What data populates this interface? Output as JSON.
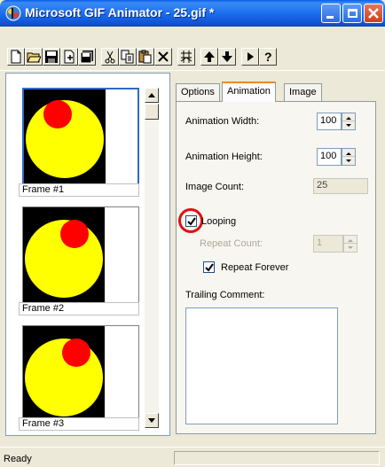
{
  "window": {
    "title": "Microsoft GIF Animator - 25.gif *"
  },
  "toolbar": {
    "buttons": [
      {
        "name": "new-button",
        "icon": "new-file-icon"
      },
      {
        "name": "open-button",
        "icon": "open-folder-icon"
      },
      {
        "name": "save-button",
        "icon": "save-disk-icon"
      },
      {
        "name": "insert-button",
        "icon": "insert-icon"
      },
      {
        "name": "save-as-button",
        "icon": "save-as-icon"
      },
      {
        "name": "cut-button",
        "icon": "scissors-icon"
      },
      {
        "name": "copy-button",
        "icon": "copy-icon"
      },
      {
        "name": "paste-button",
        "icon": "paste-icon"
      },
      {
        "name": "delete-button",
        "icon": "delete-x-icon"
      },
      {
        "name": "select-all-button",
        "icon": "select-all-icon"
      },
      {
        "name": "move-up-button",
        "icon": "arrow-up-icon"
      },
      {
        "name": "move-down-button",
        "icon": "arrow-down-icon"
      },
      {
        "name": "preview-button",
        "icon": "play-icon"
      },
      {
        "name": "help-button",
        "icon": "help-icon",
        "label": "?"
      }
    ]
  },
  "frames": [
    {
      "label": "Frame #1",
      "selected": true
    },
    {
      "label": "Frame #2",
      "selected": false
    },
    {
      "label": "Frame #3",
      "selected": false
    }
  ],
  "tabs": [
    {
      "label": "Options",
      "active": false
    },
    {
      "label": "Animation",
      "active": true
    },
    {
      "label": "Image",
      "active": false
    }
  ],
  "animation": {
    "width_label": "Animation Width:",
    "width_value": "100",
    "height_label": "Animation Height:",
    "height_value": "100",
    "image_count_label": "Image Count:",
    "image_count_value": "25",
    "looping_label": "Looping",
    "looping_checked": true,
    "repeat_count_label": "Repeat Count:",
    "repeat_count_value": "1",
    "repeat_forever_label": "Repeat Forever",
    "repeat_forever_checked": true,
    "trailing_comment_label": "Trailing Comment:",
    "trailing_comment_value": ""
  },
  "status": {
    "text": "Ready"
  },
  "colors": {
    "frame_background": "#000000",
    "circle_yellow": "#ffff00",
    "dot_red": "#ff0000",
    "highlight_ring": "#e01010"
  }
}
